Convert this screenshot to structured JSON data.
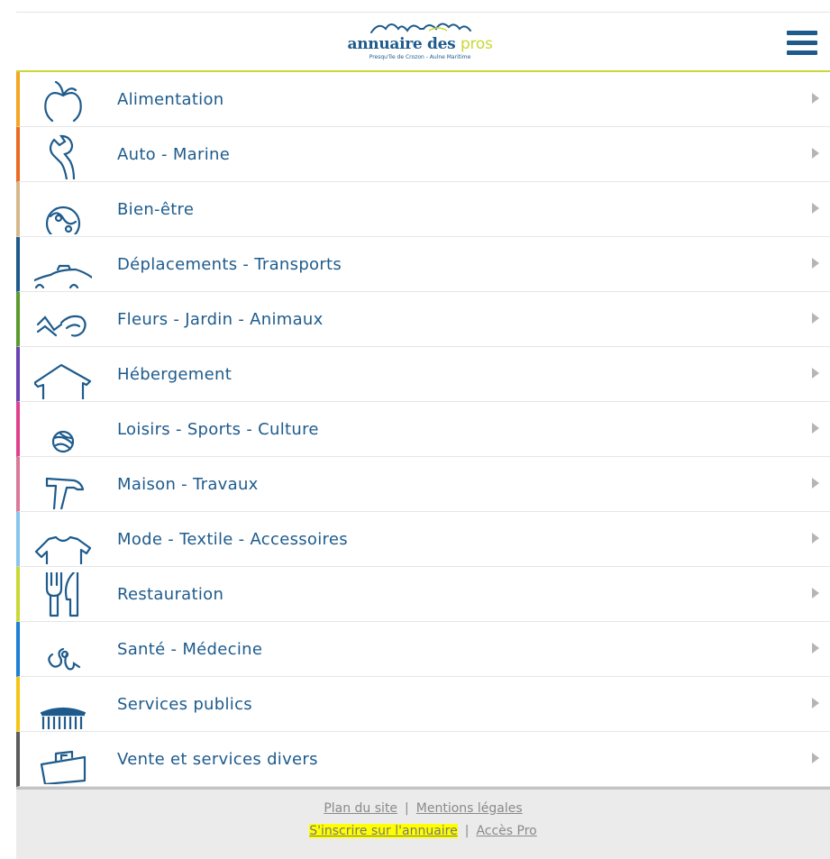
{
  "header": {
    "logo_word_main": "annuaire des ",
    "logo_word_accent": "pros",
    "logo_tagline": "Presqu'île de Crozon - Aulne Maritime",
    "menu_icon": "hamburger-menu-icon"
  },
  "categories": [
    {
      "label": "Alimentation",
      "color": "#f5a623",
      "icon": "apple-icon"
    },
    {
      "label": "Auto - Marine",
      "color": "#ec6b24",
      "icon": "wrench-icon"
    },
    {
      "label": "Bien-être",
      "color": "#d6b88c",
      "icon": "yin-yang-icon"
    },
    {
      "label": "Déplacements - Transports",
      "color": "#1e5b8c",
      "icon": "car-icon"
    },
    {
      "label": "Fleurs - Jardin - Animaux",
      "color": "#5b9a2c",
      "icon": "watering-can-icon"
    },
    {
      "label": "Hébergement",
      "color": "#6b44b4",
      "icon": "house-icon"
    },
    {
      "label": "Loisirs - Sports - Culture",
      "color": "#e0408e",
      "icon": "ball-icon"
    },
    {
      "label": "Maison - Travaux",
      "color": "#d97a9a",
      "icon": "hammer-icon"
    },
    {
      "label": "Mode - Textile - Accessoires",
      "color": "#89c5ec",
      "icon": "tshirt-icon"
    },
    {
      "label": "Restauration",
      "color": "#c8d935",
      "icon": "fork-knife-icon"
    },
    {
      "label": "Santé - Médecine",
      "color": "#1e7fd6",
      "icon": "stethoscope-icon"
    },
    {
      "label": "Services publics",
      "color": "#f5c518",
      "icon": "public-building-icon"
    },
    {
      "label": "Vente et services divers",
      "color": "#5c5c5c",
      "icon": "shopping-bag-icon"
    }
  ],
  "footer": {
    "plan_du_site": "Plan du site",
    "separator": "|",
    "mentions_legales": "Mentions légales",
    "inscrire": "S'inscrire sur l'annuaire",
    "acces_pro": "Accès Pro",
    "highlight_color": "#ffff00"
  }
}
